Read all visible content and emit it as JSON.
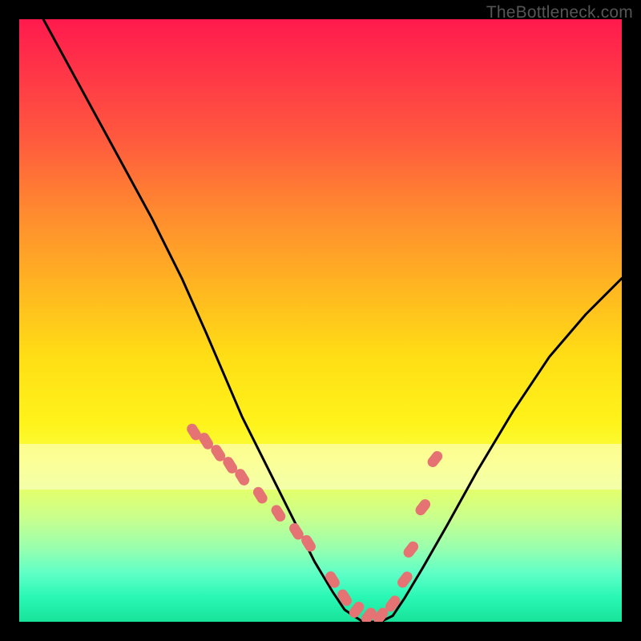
{
  "watermark": "TheBottleneck.com",
  "chart_data": {
    "type": "line",
    "title": "",
    "xlabel": "",
    "ylabel": "",
    "xlim": [
      0,
      100
    ],
    "ylim": [
      0,
      100
    ],
    "grid": false,
    "legend": false,
    "series": [
      {
        "name": "bottleneck-curve",
        "x": [
          4,
          10,
          16,
          22,
          27,
          31,
          34,
          37,
          40,
          43,
          46,
          49,
          52,
          54,
          57,
          60,
          62,
          64,
          67,
          71,
          76,
          82,
          88,
          94,
          100
        ],
        "y": [
          100,
          89,
          78,
          67,
          57,
          48,
          41,
          34,
          28,
          22,
          16,
          10,
          5,
          2,
          0,
          0,
          1,
          4,
          9,
          16,
          25,
          35,
          44,
          51,
          57
        ]
      },
      {
        "name": "dot-markers",
        "x": [
          29,
          31,
          33,
          35,
          37,
          40,
          43,
          46,
          48,
          52,
          54,
          56,
          58,
          60,
          62,
          64,
          65,
          67,
          69
        ],
        "y": [
          31.5,
          30,
          28,
          26,
          24,
          21,
          18,
          15,
          13,
          7,
          4,
          2,
          1,
          1,
          3,
          7,
          12,
          19,
          27
        ]
      }
    ],
    "band": {
      "y_from": 22,
      "y_to": 30
    },
    "background_gradient": {
      "orientation": "vertical",
      "stops": [
        {
          "pos": 0.0,
          "color": "#ff1a4d"
        },
        {
          "pos": 0.35,
          "color": "#ff8a2f"
        },
        {
          "pos": 0.6,
          "color": "#ffe018"
        },
        {
          "pos": 0.82,
          "color": "#d8ff78"
        },
        {
          "pos": 1.0,
          "color": "#18e39a"
        }
      ]
    }
  }
}
